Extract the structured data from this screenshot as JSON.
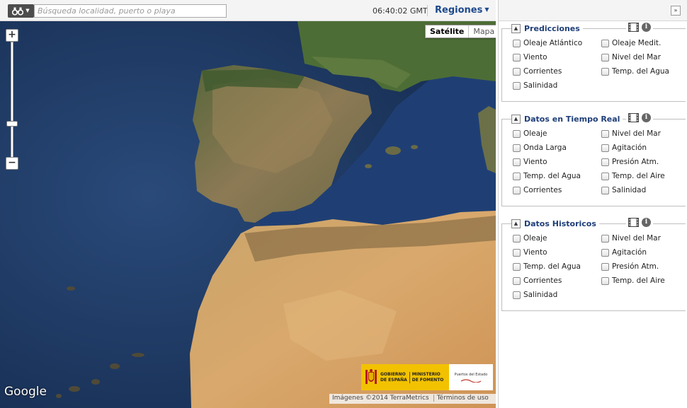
{
  "toolbar": {
    "menu_icon": "binoculars-icon",
    "search_placeholder": "Búsqueda localidad, puerto o playa",
    "clock": "06:40:02 GMT",
    "regions_label": "Regiones"
  },
  "map": {
    "type_buttons": {
      "satellite": "Satélite",
      "map": "Mapa"
    },
    "zoom": {
      "in": "+",
      "out": "−"
    },
    "google_logo": "Google",
    "attribution": "Imágenes ©2014 TerraMetrics",
    "terms": "Términos de uso",
    "ministry": {
      "gobierno_line1": "GOBIERNO",
      "gobierno_line2": "DE ESPAÑA",
      "ministerio_line1": "MINISTERIO",
      "ministerio_line2": "DE FOMENTO",
      "puertos": "Puertos del Estado"
    }
  },
  "panel": {
    "collapse_label": "»",
    "sections": [
      {
        "title": "Predicciones",
        "items_left": [
          "Oleaje Atlántico",
          "Viento",
          "Corrientes",
          "Salinidad"
        ],
        "items_right": [
          "Oleaje Medit.",
          "Nivel del Mar",
          "Temp. del Agua"
        ]
      },
      {
        "title": "Datos en Tiempo Real",
        "items_left": [
          "Oleaje",
          "Onda Larga",
          "Viento",
          "Temp. del Agua",
          "Corrientes"
        ],
        "items_right": [
          "Nivel del Mar",
          "Agitación",
          "Presión Atm.",
          "Temp. del Aire",
          "Salinidad"
        ]
      },
      {
        "title": "Datos Historicos",
        "items_left": [
          "Oleaje",
          "Viento",
          "Temp. del Agua",
          "Corrientes",
          "Salinidad"
        ],
        "items_right": [
          "Nivel del Mar",
          "Agitación",
          "Presión Atm.",
          "Temp. del Aire"
        ]
      }
    ]
  }
}
